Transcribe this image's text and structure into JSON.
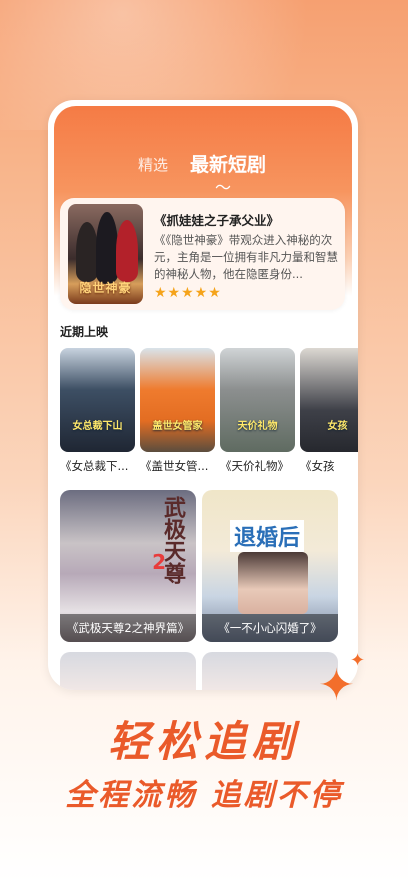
{
  "tabs": {
    "recommended": "精选",
    "new_dramas": "最新短剧",
    "underline": "〜"
  },
  "featured": {
    "title": "《抓娃娃之子承父业》",
    "description": "《《隐世神豪》带观众进入神秘的次元，主角是一位拥有非凡力量和智慧的神秘人物，他在隐匿身份...",
    "poster_text": "隐世神豪",
    "rating_stars": 5,
    "stars_display": "★★★★★"
  },
  "recent": {
    "title": "近期上映",
    "items": [
      {
        "label": "《女总裁下...",
        "poster_tag": "女总裁下山"
      },
      {
        "label": "《盖世女管...",
        "poster_tag": "盖世女管家"
      },
      {
        "label": "《天价礼物》",
        "poster_tag": "天价礼物"
      },
      {
        "label": "《女孩",
        "poster_tag": "女孩"
      }
    ]
  },
  "grid": [
    {
      "caption": "《武极天尊2之神界篇》",
      "art_text": "武极天尊",
      "art_num": "2"
    },
    {
      "caption": "《一不小心闪婚了》",
      "art_text": "退婚后"
    }
  ],
  "tagline": {
    "line1": "轻松追剧",
    "line2": "全程流畅 追剧不停"
  },
  "colors": {
    "accent": "#ea5a2a",
    "header": "#f57b45",
    "star": "#f5a31a"
  }
}
